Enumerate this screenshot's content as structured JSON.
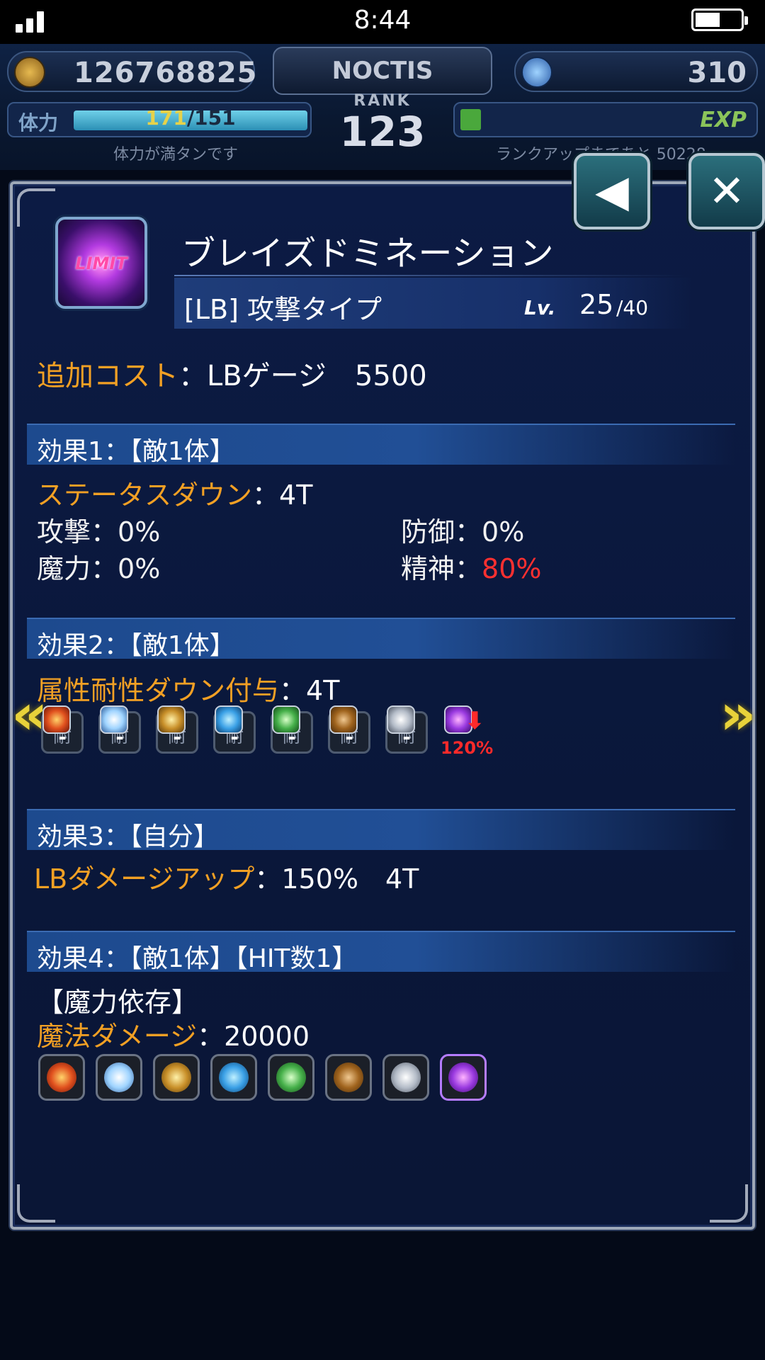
{
  "status_bar": {
    "time": "8:44"
  },
  "hud": {
    "gil": "126768825",
    "player_name": "NOCTIS",
    "rank_label": "RANK",
    "rank": "123",
    "gems": "310",
    "stamina_label": "体力",
    "stamina_current": "171",
    "stamina_max": "/151",
    "stamina_message": "体力が満タンです",
    "exp_label": "EXP",
    "exp_message": "ランクアップまであと 50228",
    "exp_progress_fraction": 0.07
  },
  "buttons": {
    "back_icon": "back-triangle-icon",
    "close_icon": "close-x-icon"
  },
  "skill": {
    "icon_text": "LIMIT",
    "name": "ブレイズドミネーション",
    "type": "[LB] 攻撃タイプ",
    "lv_label": "Lv.",
    "lv_current": "25",
    "lv_max": "/40"
  },
  "cost": {
    "label": "追加コスト",
    "value": "：LBゲージ　5500"
  },
  "effects": [
    {
      "header": "効果1：【敵1体】",
      "title": "ステータスダウン",
      "title_value": "：4T",
      "stats": [
        {
          "label": "攻撃",
          "value": "：0%"
        },
        {
          "label": "防御",
          "value": "：0%"
        },
        {
          "label": "魔力",
          "value": "：0%"
        },
        {
          "label": "精神",
          "value": "：",
          "highlight": "80%"
        }
      ]
    },
    {
      "header": "効果2：【敵1体】",
      "title": "属性耐性ダウン付与",
      "title_value": "：4T",
      "resists": [
        {
          "element": "fire",
          "value": "-"
        },
        {
          "element": "ice",
          "value": "-"
        },
        {
          "element": "lightning",
          "value": "-"
        },
        {
          "element": "water",
          "value": "-"
        },
        {
          "element": "wind",
          "value": "-"
        },
        {
          "element": "earth",
          "value": "-"
        },
        {
          "element": "light",
          "value": "-"
        },
        {
          "element": "dark",
          "value": "120%"
        }
      ],
      "resist_box_text": "耐"
    },
    {
      "header": "効果3：【自分】",
      "title": "LBダメージアップ",
      "title_value": "：150%　4T"
    },
    {
      "header": "効果4：【敵1体】【HIT数1】",
      "subtitle": "【魔力依存】",
      "title": "魔法ダメージ",
      "title_value": "：20000",
      "elements": [
        "fire",
        "ice",
        "lightning",
        "water",
        "wind",
        "earth",
        "light",
        "dark"
      ]
    }
  ],
  "colors": {
    "accent_orange": "#f2a024",
    "highlight_red": "#ff3030",
    "header_blue": "#1d4a8e",
    "panel_bg": "#0c1b44"
  }
}
